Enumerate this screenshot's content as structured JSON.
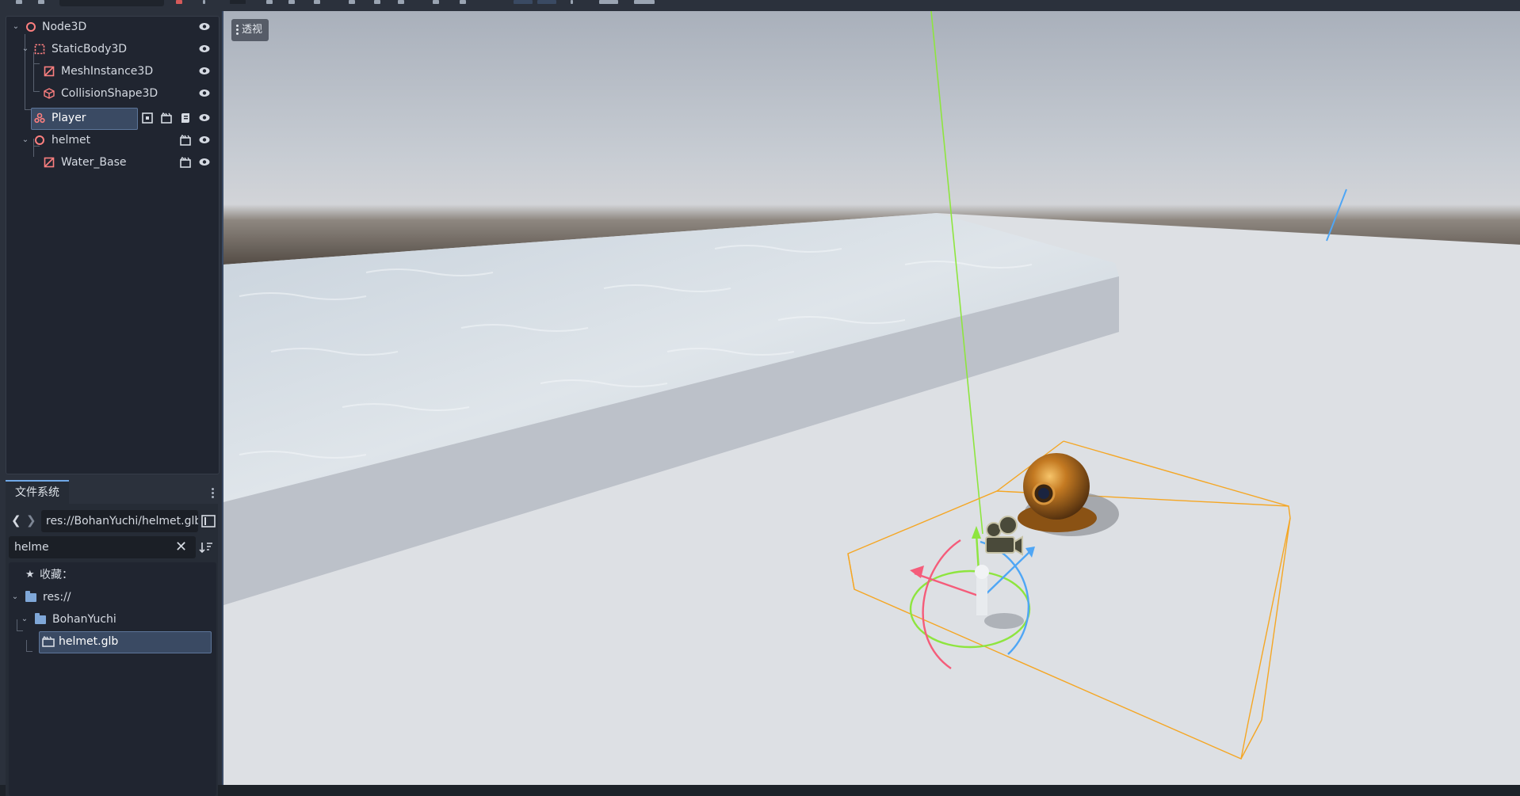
{
  "scene_tree": {
    "nodes": [
      {
        "label": "Node3D"
      },
      {
        "label": "StaticBody3D"
      },
      {
        "label": "MeshInstance3D"
      },
      {
        "label": "CollisionShape3D"
      },
      {
        "label": "Player"
      },
      {
        "label": "helmet"
      },
      {
        "label": "Water_Base"
      }
    ]
  },
  "filesystem": {
    "tab_label": "文件系统",
    "path_value": "res://BohanYuchi/helmet.glb",
    "search_value": "helme",
    "favorites_label": "收藏：",
    "items": [
      {
        "label": "res://"
      },
      {
        "label": "BohanYuchi"
      },
      {
        "label": "helmet.glb"
      }
    ]
  },
  "viewport": {
    "view_mode_label": "透视"
  },
  "colors": {
    "accent": "#70a8e8",
    "node3d": "#fc7f7f",
    "selection": "#3a4a63",
    "gizmo_green": "#8ee53f",
    "gizmo_blue": "#4fa6f5",
    "gizmo_red": "#f55c7a",
    "bounds_orange": "#f5a623"
  }
}
